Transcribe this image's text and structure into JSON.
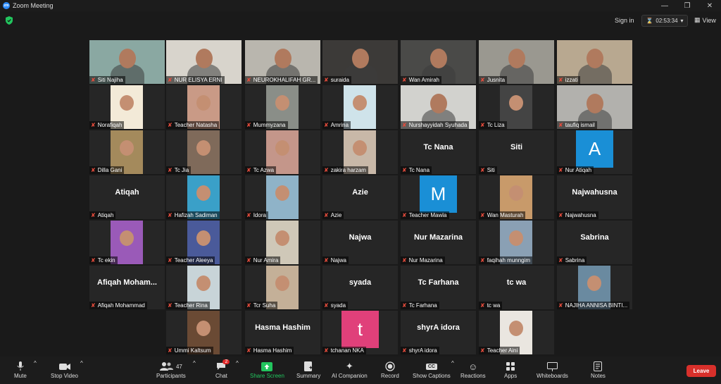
{
  "window": {
    "title": "Zoom Meeting",
    "logo": "zm"
  },
  "topbar": {
    "signin": "Sign in",
    "timer": "02:53:34",
    "view": "View"
  },
  "tiles": [
    {
      "name": "Siti Najiha",
      "type": "video",
      "bg": "#8aa8a2"
    },
    {
      "name": "NUR ELISYA ERNI",
      "type": "video",
      "bg": "#d8d4cc"
    },
    {
      "name": "NEUROKHALIFAH GR...",
      "type": "video",
      "bg": "#b9b6ae"
    },
    {
      "name": "suraida",
      "type": "video",
      "bg": "#3c3a38"
    },
    {
      "name": "Wan Amirah",
      "type": "video",
      "bg": "#4a4a48"
    },
    {
      "name": "Jusnita",
      "type": "video",
      "bg": "#9a9890"
    },
    {
      "name": "izzati",
      "type": "video",
      "bg": "#b8a890"
    },
    {
      "name": "Norafiqah",
      "type": "photo",
      "bg": "#f3ead8"
    },
    {
      "name": "Teacher Natasha",
      "type": "photo",
      "bg": "#c99a86"
    },
    {
      "name": "Mummyzana",
      "type": "photo",
      "bg": "#8a8e88"
    },
    {
      "name": "Amrina",
      "type": "photo",
      "bg": "#cfe3ea"
    },
    {
      "name": "Nurshayyidah Syuhada",
      "type": "video",
      "bg": "#d2d2ce"
    },
    {
      "name": "Tc Liza",
      "type": "photo",
      "bg": "#444"
    },
    {
      "name": "taufiq ismail",
      "type": "video",
      "bg": "#b2b1ad"
    },
    {
      "name": "Dilla Gani",
      "type": "photo",
      "bg": "#a48a5c"
    },
    {
      "name": "Tc Jia",
      "type": "photo",
      "bg": "#7f6a5a"
    },
    {
      "name": "Tc Azwa",
      "type": "photo",
      "bg": "#c4968a"
    },
    {
      "name": "zakira harzam",
      "type": "photo",
      "bg": "#c8b8a8"
    },
    {
      "name": "Tc Nana",
      "type": "text",
      "display": "Tc Nana"
    },
    {
      "name": "Siti",
      "type": "text",
      "display": "Siti"
    },
    {
      "name": "Nur Atiqah",
      "type": "avatar",
      "letter": "A",
      "bg": "#1a8fd6"
    },
    {
      "name": "Atiqah",
      "type": "text",
      "display": "Atiqah"
    },
    {
      "name": "Hafizah Sadiman",
      "type": "photo",
      "bg": "#3aa0c8"
    },
    {
      "name": "Idora",
      "type": "photo",
      "bg": "#8fb3c8"
    },
    {
      "name": "Azie",
      "type": "text",
      "display": "Azie"
    },
    {
      "name": "Teacher Mawla",
      "type": "avatar",
      "letter": "M",
      "bg": "#1a8fd6"
    },
    {
      "name": "Wan Masturah",
      "type": "photo",
      "bg": "#c89a6a"
    },
    {
      "name": "Najwahusna",
      "type": "text",
      "display": "Najwahusna"
    },
    {
      "name": "Tc ekin",
      "type": "photo",
      "bg": "#9a5ab8"
    },
    {
      "name": "Teacher Aleeya",
      "type": "photo",
      "bg": "#4a5a9a"
    },
    {
      "name": "Nur Amira",
      "type": "photo",
      "bg": "#cfc8b8"
    },
    {
      "name": "Najwa",
      "type": "text",
      "display": "Najwa"
    },
    {
      "name": "Nur Mazarina",
      "type": "text",
      "display": "Nur Mazarina"
    },
    {
      "name": "faqihah munngim",
      "type": "photo",
      "bg": "#8aa0b4"
    },
    {
      "name": "Sabrina",
      "type": "text",
      "display": "Sabrina"
    },
    {
      "name": "Afiqah Mohammad",
      "type": "text",
      "display": "Afiqah  Moham..."
    },
    {
      "name": "Teacher Rina",
      "type": "photo",
      "bg": "#c8d4d8"
    },
    {
      "name": "Tcr Suha",
      "type": "photo",
      "bg": "#c4b098"
    },
    {
      "name": "syada",
      "type": "text",
      "display": "syada"
    },
    {
      "name": "Tc Farhana",
      "type": "text",
      "display": "Tc Farhana"
    },
    {
      "name": "tc wa",
      "type": "text",
      "display": "tc wa"
    },
    {
      "name": "NAJIHA ANNISA BINTI...",
      "type": "photo",
      "bg": "#6a8aa0"
    },
    {
      "name": "Ummi Kaltsum",
      "type": "photo",
      "bg": "#6a4a34"
    },
    {
      "name": "Hasma Hashim",
      "type": "text",
      "display": "Hasma Hashim"
    },
    {
      "name": "tchanan NKA",
      "type": "avatar",
      "letter": "t",
      "bg": "#e0407a"
    },
    {
      "name": "shyrA idora",
      "type": "text",
      "display": "shyrA idora"
    },
    {
      "name": "Teacher Aini",
      "type": "photo",
      "bg": "#eae6e0"
    }
  ],
  "toolbar": {
    "mute": "Mute",
    "stop_video": "Stop Video",
    "participants": "Participants",
    "participants_count": "47",
    "chat": "Chat",
    "chat_badge": "2",
    "share_screen": "Share Screen",
    "summary": "Summary",
    "ai_companion": "AI Companion",
    "record": "Record",
    "show_captions": "Show Captions",
    "captions_icon": "CC",
    "reactions": "Reactions",
    "apps": "Apps",
    "whiteboards": "Whiteboards",
    "notes": "Notes",
    "leave": "Leave"
  },
  "colors": {
    "share_green": "#22c55e",
    "leave_red": "#d8302b",
    "active_speaker": "#e5e05a",
    "avatar_blue": "#1a8fd6"
  }
}
